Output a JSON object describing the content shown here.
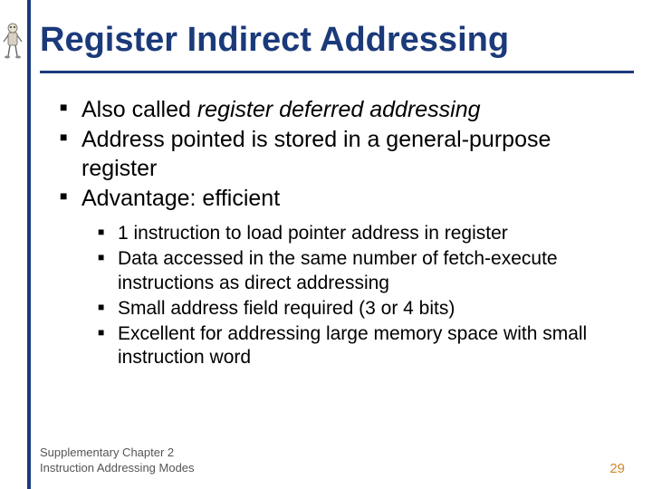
{
  "title": "Register Indirect Addressing",
  "bullets": {
    "b1_pre": "Also called ",
    "b1_italic": "register deferred addressing",
    "b2": "Address pointed is stored in a general-purpose register",
    "b3": "Advantage:  efficient"
  },
  "sub_bullets": {
    "s1": "1 instruction to load pointer address in register",
    "s2": "Data accessed in the same number of fetch-execute instructions as direct addressing",
    "s3": "Small address field required (3 or 4 bits)",
    "s4": "Excellent for addressing large memory space with small instruction word"
  },
  "footer": {
    "line1": "Supplementary Chapter 2",
    "line2": "Instruction Addressing Modes",
    "page": "29"
  }
}
